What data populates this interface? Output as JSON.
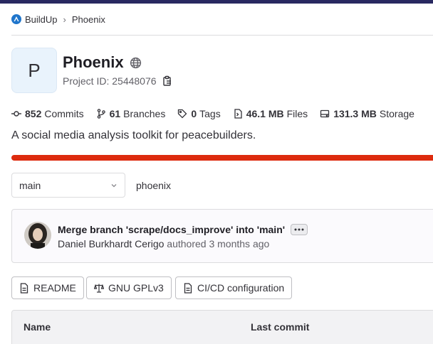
{
  "breadcrumb": {
    "group": "BuildUp",
    "project": "Phoenix"
  },
  "project": {
    "avatar_letter": "P",
    "name": "Phoenix",
    "id_text": "Project ID: 25448076",
    "description": "A social media analysis toolkit for peacebuilders."
  },
  "stats": {
    "commits_count": "852",
    "commits_label": "Commits",
    "branches_count": "61",
    "branches_label": "Branches",
    "tags_count": "0",
    "tags_label": "Tags",
    "files_size": "46.1 MB",
    "files_label": "Files",
    "storage_size": "131.3 MB",
    "storage_label": "Storage"
  },
  "language_bar": {
    "color": "#dd2b0e",
    "fraction": 1.0
  },
  "repo": {
    "branch": "main",
    "path": "phoenix"
  },
  "last_commit": {
    "title": "Merge branch 'scrape/docs_improve' into 'main'",
    "author": "Daniel Burkhardt Cerigo",
    "verb": "authored",
    "time": "3 months ago"
  },
  "buttons": {
    "readme": "README",
    "license": "GNU GPLv3",
    "cicd": "CI/CD configuration"
  },
  "table": {
    "col_name": "Name",
    "col_last_commit": "Last commit"
  },
  "icons": {
    "logo": "gitlab-tanuki-icon",
    "visibility": "globe-icon",
    "copy": "copy-icon",
    "commit": "commit-icon",
    "branch": "branch-icon",
    "tag": "tag-icon",
    "file": "file-icon",
    "storage": "disk-icon"
  },
  "colors": {
    "accent": "#1f75cb",
    "topbar": "#292961",
    "language_bar": "#dd2b0e"
  }
}
